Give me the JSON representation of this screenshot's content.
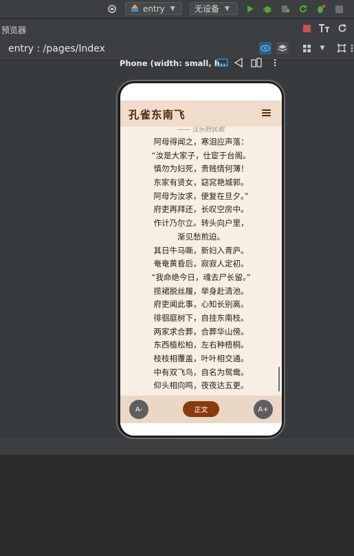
{
  "toolbar": {
    "module_select": "entry",
    "device_select": "无设备"
  },
  "preview": {
    "title": "预览器",
    "path": "entry : /pages/Index",
    "device_label": "Phone (width: small, h..."
  },
  "colors": {
    "run": "#57a639",
    "stop": "#c75450",
    "accent": "#3592c4",
    "app_header": "#efdcca",
    "app_content": "#f7eee4",
    "primary_button": "#8b3a0e"
  },
  "app": {
    "title": "孔雀东南飞",
    "author": "—— 汉乐府民歌",
    "lines": [
      "阿母得闻之，寒泪应声落：",
      "“汝是大家子，仕宦于台阁。",
      "慎勿为妇死，贵贱情何薄！",
      "东家有贤女，窈窕艳城郭。",
      "阿母为汝求，便复在旦夕。”",
      "府吏再拜还，长叹空房中。",
      "作计乃尔立。转头向户里，",
      "渐见愁煎迫。",
      "其日牛马嘶，新妇入青庐。",
      "奄奄黄昏后，寂寂人定初。",
      "“我命绝今日，魂去尸长留。”",
      "揽裙脱丝履，举身赴清池。",
      "府吏闻此事，心知长别离。",
      "徘徊庭树下，自挂东南枝。",
      "两家求合葬，合葬华山傍。",
      "东西植松柏，左右种梧桐。",
      "枝枝相覆盖，叶叶相交通。",
      "中有双飞鸟，自名为鸳鸯。",
      "仰头相向鸣，夜夜达五更。"
    ],
    "footer": {
      "decrease_font": "A-",
      "main_text": "正文",
      "increase_font": "A+"
    }
  }
}
